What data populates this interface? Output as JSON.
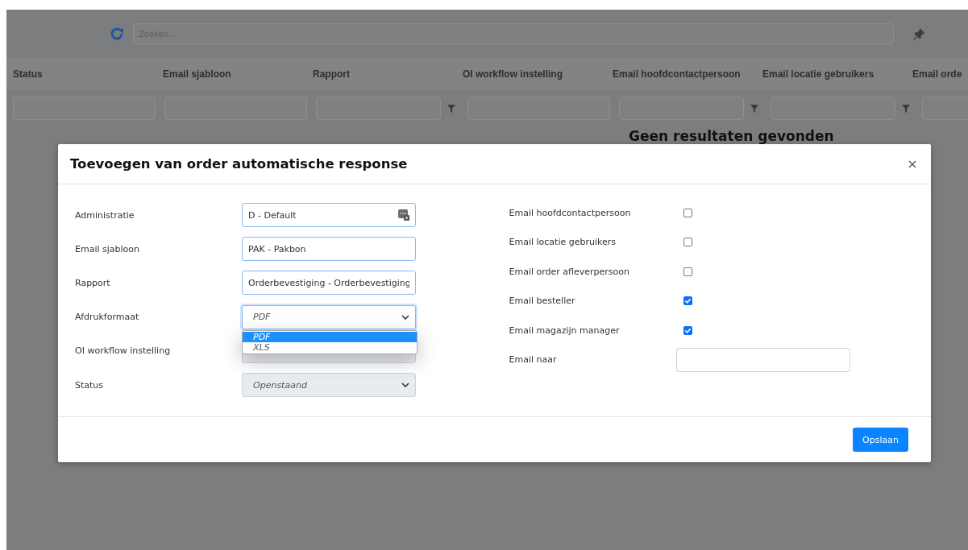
{
  "toolbar": {
    "search": {
      "placeholder": "Zoeken..."
    }
  },
  "table": {
    "columns": [
      {
        "label": "Status",
        "filter": false
      },
      {
        "label": "Email sjabloon",
        "filter": false
      },
      {
        "label": "Rapport",
        "filter": true
      },
      {
        "label": "OI workflow instelling",
        "filter": false
      },
      {
        "label": "Email hoofdcontactpersoon",
        "filter": true
      },
      {
        "label": "Email locatie gebruikers",
        "filter": true
      },
      {
        "label": "Email orde"
      }
    ],
    "empty_message": "Geen resultaten gevonden"
  },
  "dialog": {
    "title": "Toevoegen van order automatische response",
    "left_fields": [
      {
        "label": "Administratie",
        "kind": "lookup",
        "value": "D - Default",
        "disabled": false
      },
      {
        "label": "Email sjabloon",
        "kind": "text",
        "value": "PAK - Pakbon",
        "disabled": false
      },
      {
        "label": "Rapport",
        "kind": "text",
        "value": "Orderbevestiging - Orderbevestiging",
        "disabled": false
      },
      {
        "label": "Afdrukformaat",
        "kind": "select",
        "value": "PDF",
        "disabled": false,
        "expanded": true,
        "options": [
          {
            "label": "PDF",
            "selected": true
          },
          {
            "label": "XLS",
            "selected": false
          }
        ]
      },
      {
        "label": "OI workflow instelling",
        "kind": "text",
        "disabled": true
      },
      {
        "label": "Status",
        "kind": "select",
        "value": "Openstaand",
        "disabled": true,
        "expanded": false
      }
    ],
    "right_fields": [
      {
        "label": "Email hoofdcontactpersoon",
        "kind": "checkbox",
        "checked": false
      },
      {
        "label": "Email locatie gebruikers",
        "kind": "checkbox",
        "checked": false
      },
      {
        "label": "Email order afleverpersoon",
        "kind": "checkbox",
        "checked": false
      },
      {
        "label": "Email besteller",
        "kind": "checkbox",
        "checked": true
      },
      {
        "label": "Email magazijn manager",
        "kind": "checkbox",
        "checked": true
      },
      {
        "label": "Email naar",
        "kind": "text"
      }
    ],
    "save_button": "Opslaan"
  }
}
